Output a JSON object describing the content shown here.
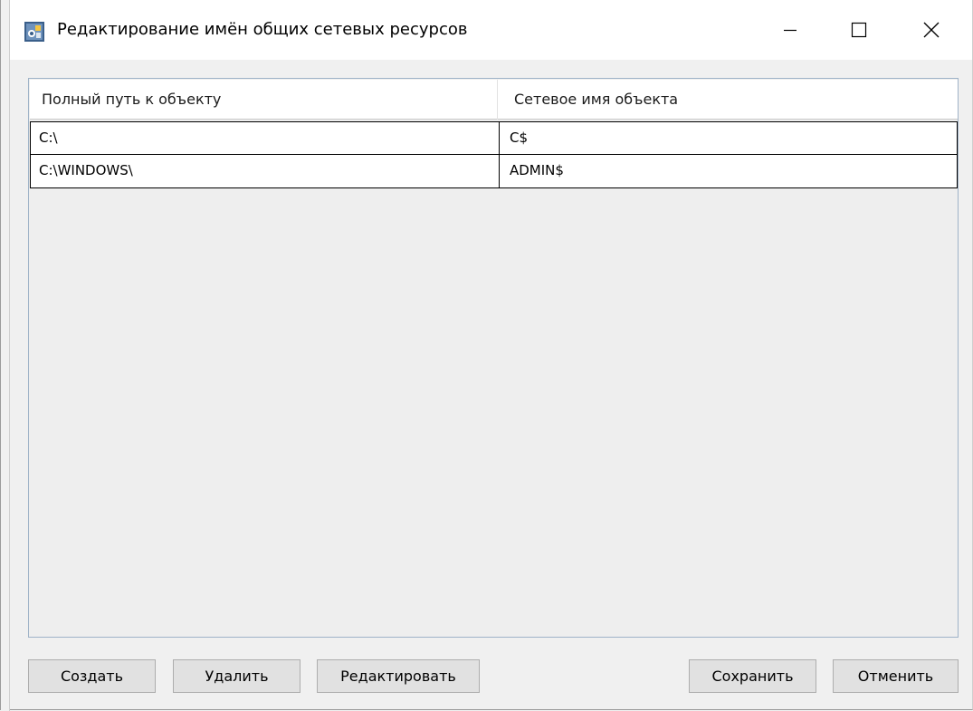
{
  "window": {
    "title": "Редактирование имён общих сетевых ресурсов",
    "icon": "network-share-app-icon"
  },
  "grid": {
    "columns": [
      "Полный путь к объекту",
      "Сетевое имя объекта"
    ],
    "rows": [
      [
        "C:\\",
        "C$"
      ],
      [
        "C:\\WINDOWS\\",
        "ADMIN$"
      ]
    ]
  },
  "buttons": {
    "create": "Создать",
    "delete": "Удалить",
    "edit": "Редактировать",
    "save": "Сохранить",
    "cancel": "Отменить"
  },
  "colors": {
    "background": "#f0f0f0",
    "titlebar": "#ffffff",
    "grid_border": "#9fb3c8",
    "button_face": "#e1e1e1"
  }
}
